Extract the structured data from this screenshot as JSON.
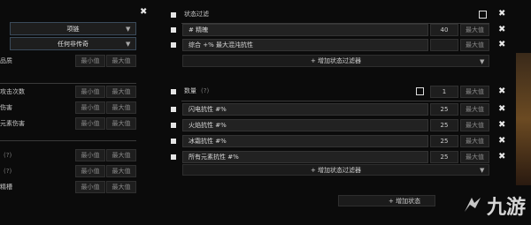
{
  "left": {
    "dropdown1": "项链",
    "dropdown2": "任何非传奇",
    "quality_label": "品质",
    "rows": [
      {
        "label": "攻击次数"
      },
      {
        "label": "伤害"
      },
      {
        "label": "元素伤害"
      }
    ],
    "rows2": [
      {
        "label": "",
        "hint": "(?)"
      },
      {
        "label": "",
        "hint": "(?)"
      },
      {
        "label": "精槽",
        "hint": ""
      }
    ]
  },
  "panel1": {
    "title": "状态过滤",
    "stats": [
      {
        "name": "# 精魄",
        "value": "40",
        "max_label": "最大值"
      },
      {
        "name": "综合 +% 最大混沌抗性",
        "value": "",
        "max_label": "最大值"
      }
    ],
    "add_label": "+ 增加状态过滤器"
  },
  "panel2": {
    "title": "数量",
    "hint": "(?)",
    "count_value": "1",
    "count_max": "最大值",
    "stats": [
      {
        "name": "闪电抗性 #%",
        "value": "25",
        "max_label": "最大值"
      },
      {
        "name": "火焰抗性 #%",
        "value": "25",
        "max_label": "最大值"
      },
      {
        "name": "冰霜抗性 #%",
        "value": "25",
        "max_label": "最大值"
      },
      {
        "name": "所有元素抗性 #%",
        "value": "25",
        "max_label": "最大值"
      }
    ],
    "add_label": "+ 增加状态过滤器"
  },
  "bottom_add": "+ 增加状态",
  "min_label": "最小值",
  "max_label": "最大值",
  "watermark": "九游"
}
